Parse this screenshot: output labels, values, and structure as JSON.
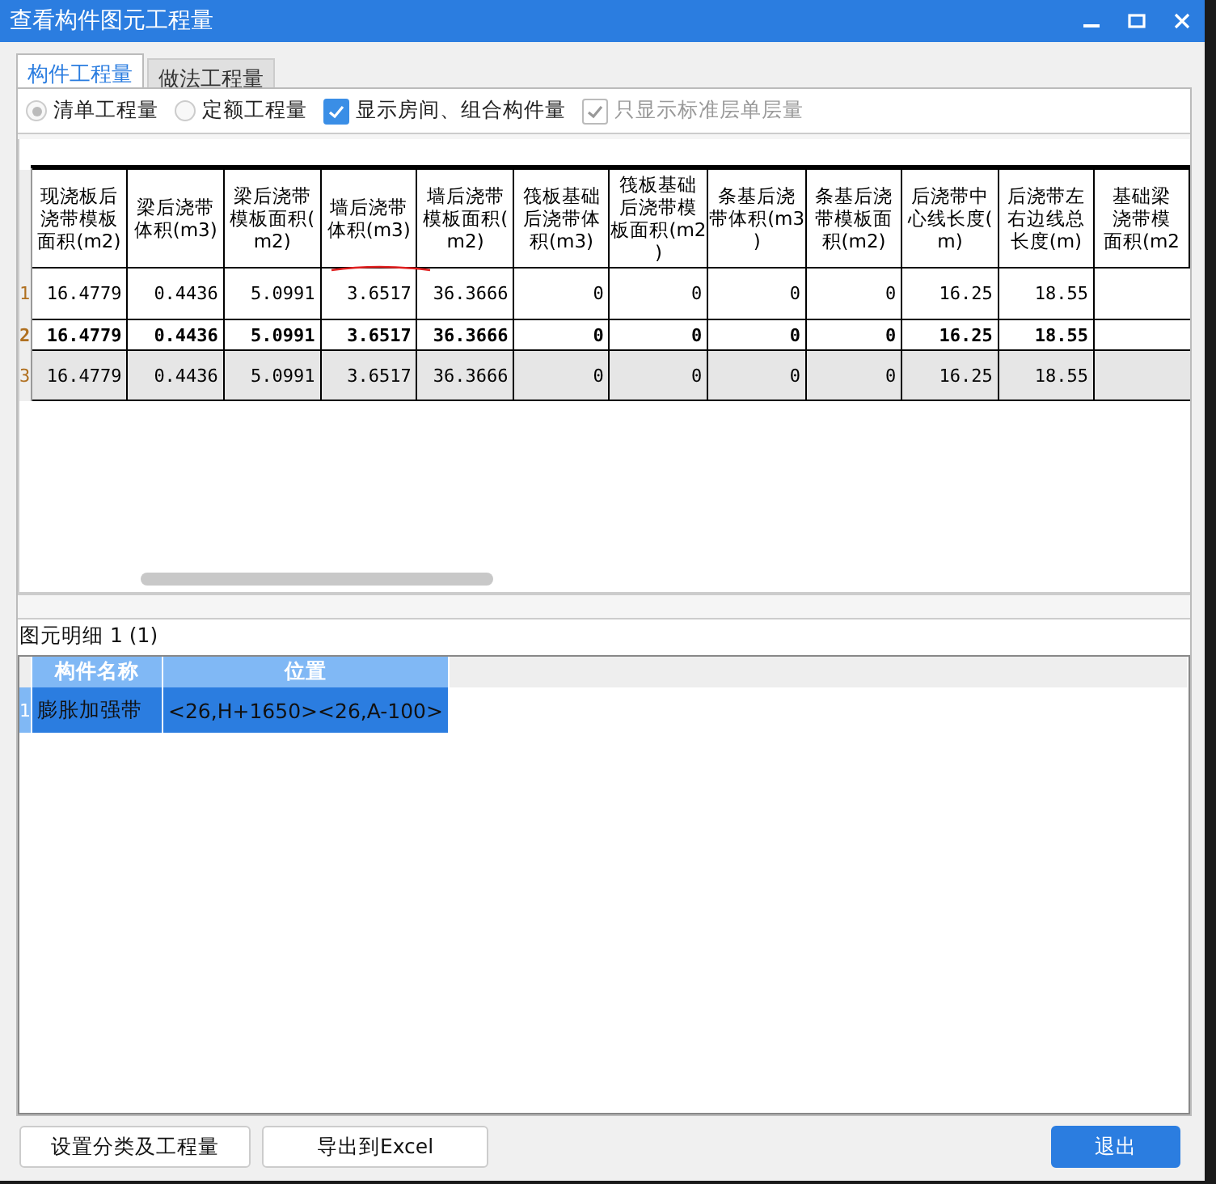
{
  "window": {
    "title": "查看构件图元工程量"
  },
  "tabs": [
    {
      "label": "构件工程量",
      "selected": true
    },
    {
      "label": "做法工程量",
      "selected": false
    }
  ],
  "options": [
    {
      "kind": "radio",
      "label": "清单工程量",
      "checked": true,
      "disabled": true
    },
    {
      "kind": "radio",
      "label": "定额工程量",
      "checked": false,
      "disabled": true
    },
    {
      "kind": "checkbox",
      "label": "显示房间、组合构件量",
      "checked": true,
      "disabled": false
    },
    {
      "kind": "checkbox",
      "label": "只显示标准层单层量",
      "checked": true,
      "disabled": true
    }
  ],
  "quantity_table": {
    "columns": [
      {
        "lines": [
          "现浇板后",
          "浇带模板",
          "面积(m2)"
        ]
      },
      {
        "lines": [
          "梁后浇带",
          "体积(m3)"
        ]
      },
      {
        "lines": [
          "梁后浇带",
          "模板面积(",
          "m2)"
        ]
      },
      {
        "lines": [
          "墙后浇带",
          "体积(m3)"
        ]
      },
      {
        "lines": [
          "墙后浇带",
          "模板面积(",
          "m2)"
        ]
      },
      {
        "lines": [
          "筏板基础",
          "后浇带体",
          "积(m3)"
        ]
      },
      {
        "lines": [
          "筏板基础",
          "后浇带模",
          "板面积(m2",
          ")"
        ]
      },
      {
        "lines": [
          "条基后浇",
          "带体积(m3",
          ")"
        ]
      },
      {
        "lines": [
          "条基后浇",
          "带模板面",
          "积(m2)"
        ]
      },
      {
        "lines": [
          "后浇带中",
          "心线长度(",
          "m)"
        ]
      },
      {
        "lines": [
          "后浇带左",
          "右边线总",
          "长度(m)"
        ]
      },
      {
        "lines": [
          "基础梁",
          "浇带模",
          "面积(m2"
        ]
      }
    ],
    "rows": [
      {
        "number": "1",
        "kind": "normal",
        "cells": [
          "16.4779",
          "0.4436",
          "5.0991",
          "3.6517",
          "36.3666",
          "0",
          "0",
          "0",
          "0",
          "16.25",
          "18.55"
        ]
      },
      {
        "number": "2",
        "kind": "bold",
        "cells": [
          "16.4779",
          "0.4436",
          "5.0991",
          "3.6517",
          "36.3666",
          "0",
          "0",
          "0",
          "0",
          "16.25",
          "18.55"
        ]
      },
      {
        "number": "3",
        "kind": "shaded",
        "cells": [
          "16.4779",
          "0.4436",
          "5.0991",
          "3.6517",
          "36.3666",
          "0",
          "0",
          "0",
          "0",
          "16.25",
          "18.55"
        ]
      }
    ]
  },
  "detail": {
    "label": "图元明细  1 (1)",
    "columns": [
      "构件名称",
      "位置"
    ],
    "rows": [
      {
        "number": "1",
        "selected": true,
        "cells": [
          "膨胀加强带",
          "<26,H+1650><26,A-100>"
        ]
      }
    ]
  },
  "buttons": [
    {
      "label": "设置分类及工程量",
      "kind": "normal"
    },
    {
      "label": "导出到Excel",
      "kind": "normal"
    },
    {
      "label": "退出",
      "kind": "primary"
    }
  ]
}
